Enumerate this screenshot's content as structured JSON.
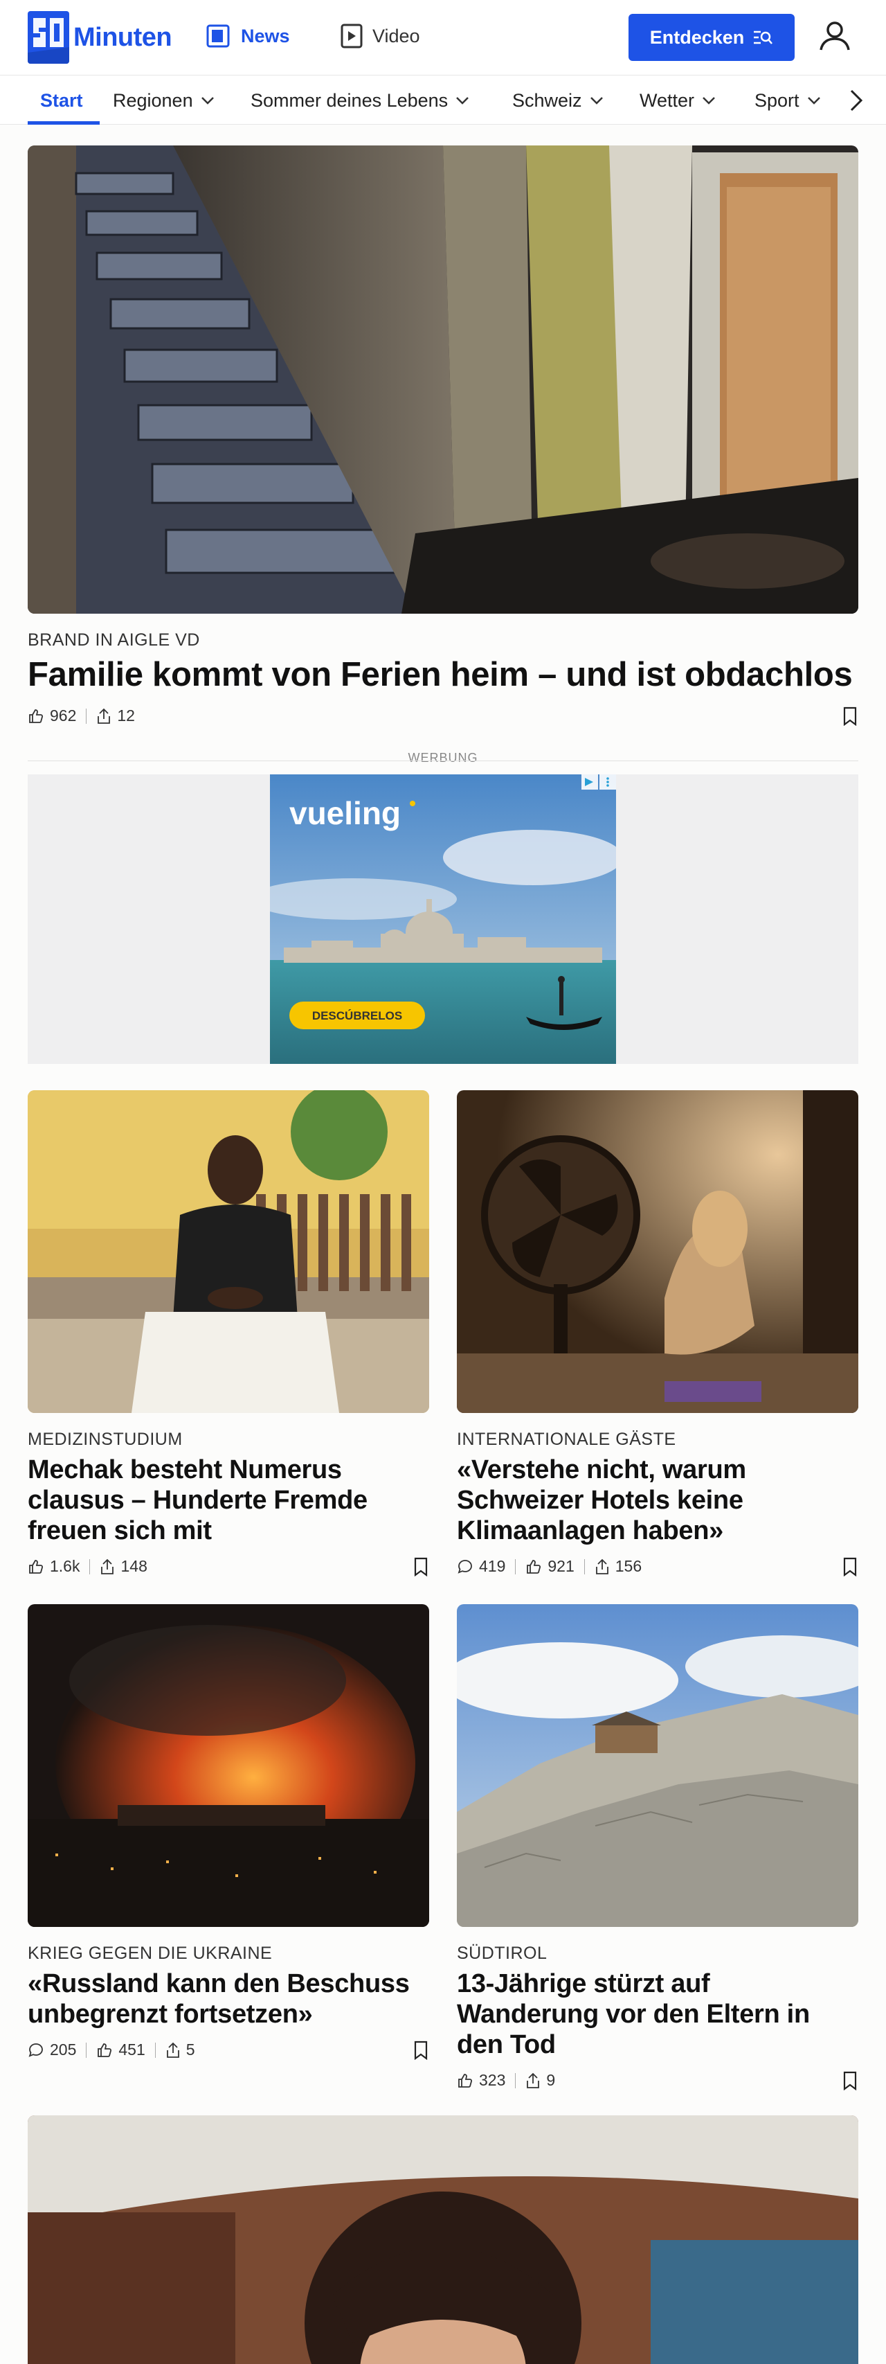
{
  "header": {
    "logo_text": "Minuten",
    "nav_news": "News",
    "nav_video": "Video",
    "entdecken": "Entdecken"
  },
  "tabs": [
    {
      "label": "Start"
    },
    {
      "label": "Regionen"
    },
    {
      "label": "Sommer deines Lebens"
    },
    {
      "label": "Schweiz"
    },
    {
      "label": "Wetter"
    },
    {
      "label": "Sport"
    }
  ],
  "ad": {
    "label": "WERBUNG",
    "brand": "vueling",
    "cta": "DESCÚBRELOS"
  },
  "articles": [
    {
      "kicker": "BRAND IN AIGLE VD",
      "title": "Familie kommt von Ferien heim – und ist obdachlos",
      "likes": "962",
      "shares": "12"
    },
    {
      "kicker": "MEDIZINSTUDIUM",
      "title": "Mechak besteht Numerus clausus – Hunderte Fremde freuen sich mit",
      "likes": "1.6k",
      "shares": "148"
    },
    {
      "kicker": "INTERNATIONALE GÄSTE",
      "title": "«Verstehe nicht, warum Schweizer Hotels keine Klimaanlagen haben»",
      "comments": "419",
      "likes": "921",
      "shares": "156"
    },
    {
      "kicker": "KRIEG GEGEN DIE UKRAINE",
      "title": "«Russland kann den Beschuss unbegrenzt fortsetzen»",
      "comments": "205",
      "likes": "451",
      "shares": "5"
    },
    {
      "kicker": "SÜDTIROL",
      "title": "13-Jährige stürzt auf Wanderung vor den Eltern in den Tod",
      "likes": "323",
      "shares": "9"
    }
  ],
  "colors": {
    "brand": "#1e53e6",
    "ad_yellow": "#f7c500"
  }
}
